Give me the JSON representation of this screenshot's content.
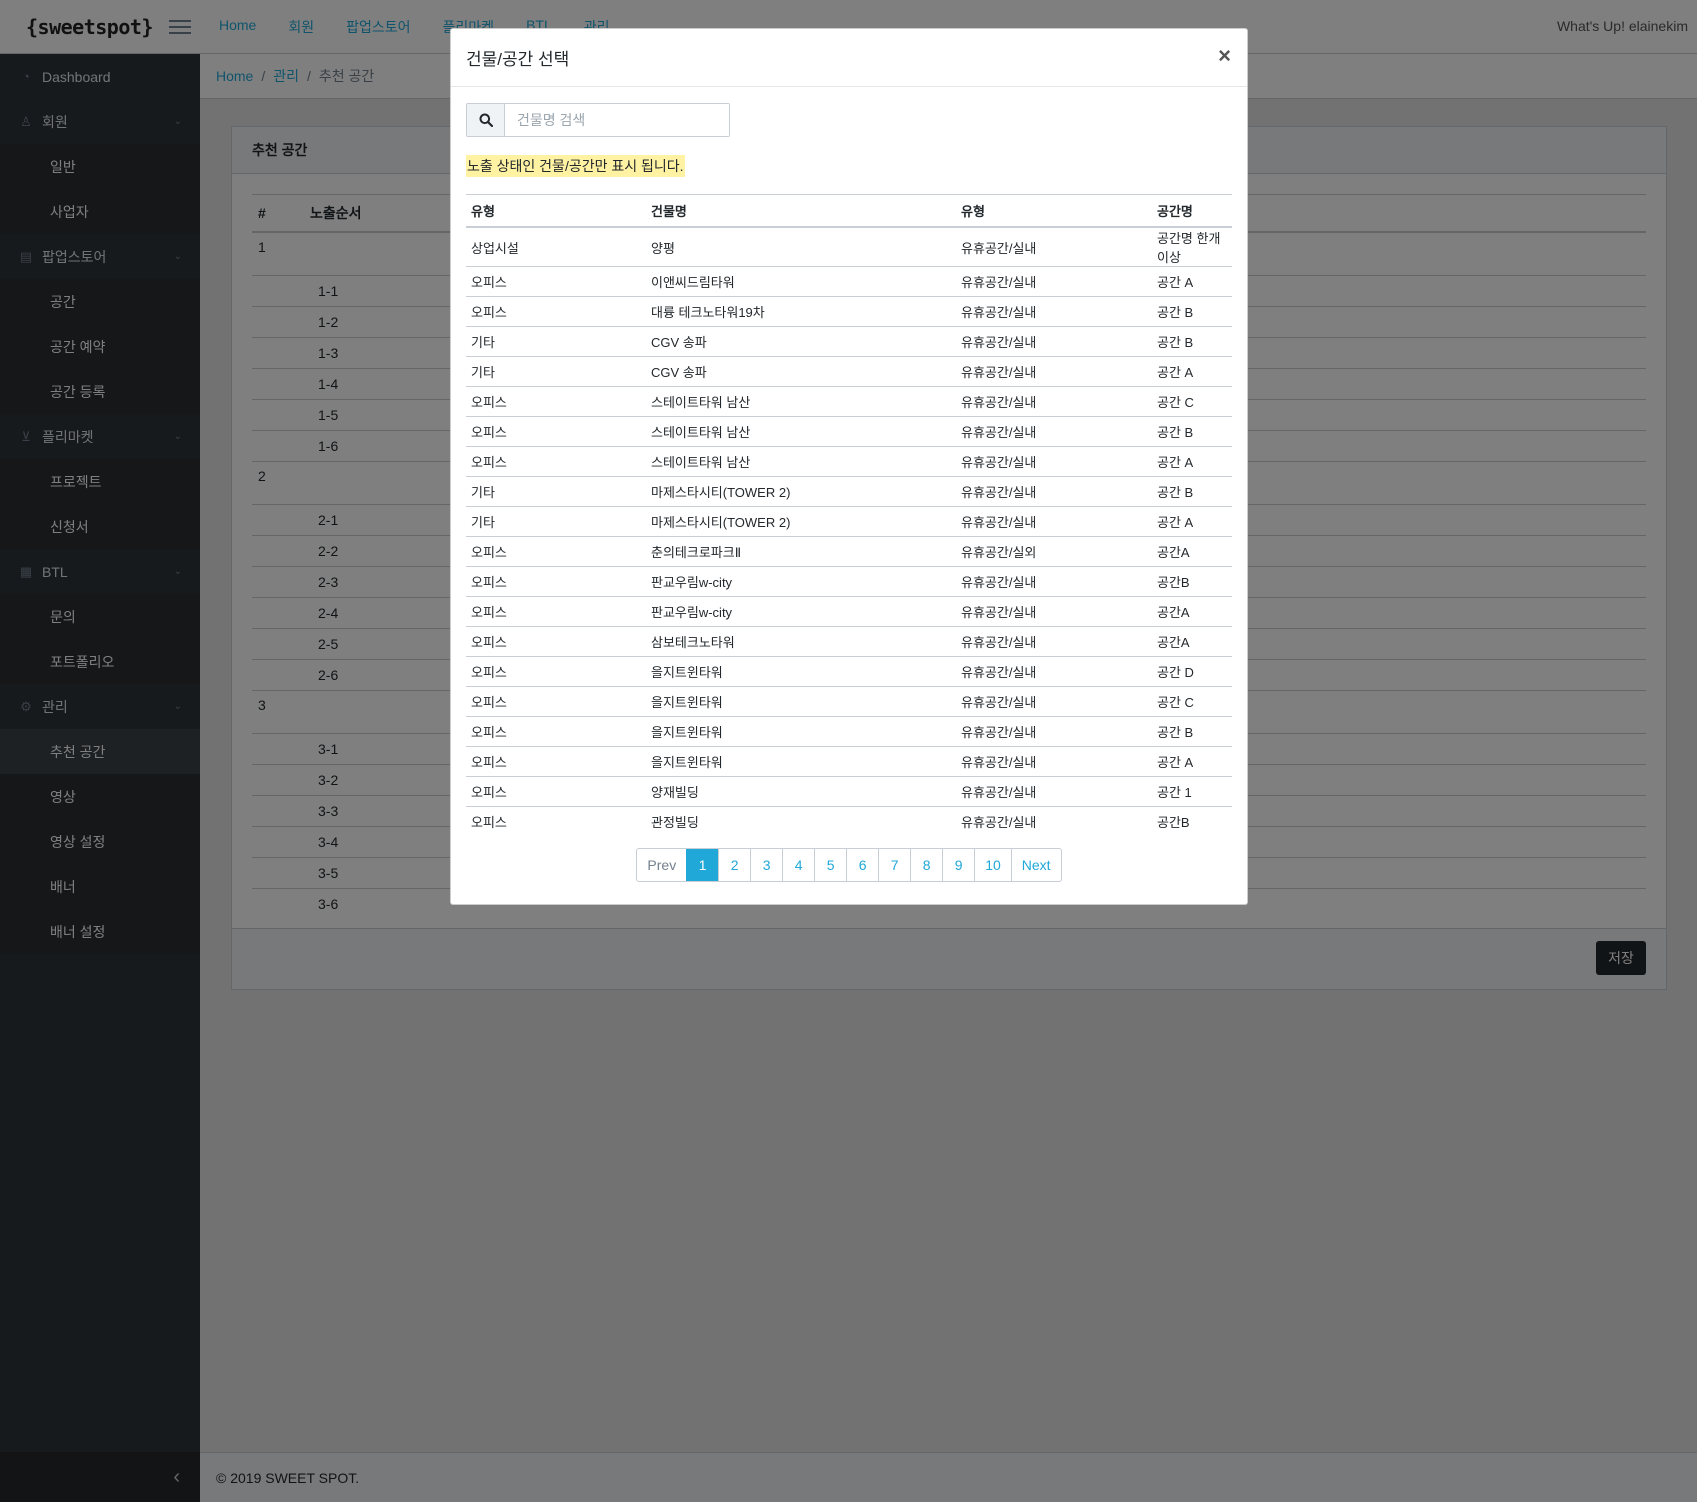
{
  "header": {
    "logo": "{sweetspot}",
    "nav": [
      "Home",
      "회원",
      "팝업스토어",
      "플리마켓",
      "BTL",
      "관리"
    ],
    "user_greeting": "What's Up! elainekim"
  },
  "sidebar": {
    "items": [
      {
        "label": "Dashboard",
        "kind": "title",
        "icon": "dashboard-icon"
      },
      {
        "label": "회원",
        "kind": "title",
        "icon": "user-icon",
        "expandable": true
      },
      {
        "label": "일반",
        "kind": "sub"
      },
      {
        "label": "사업자",
        "kind": "sub"
      },
      {
        "label": "팝업스토어",
        "kind": "title",
        "icon": "store-icon",
        "expandable": true
      },
      {
        "label": "공간",
        "kind": "sub"
      },
      {
        "label": "공간 예약",
        "kind": "sub"
      },
      {
        "label": "공간 등록",
        "kind": "sub"
      },
      {
        "label": "플리마켓",
        "kind": "title",
        "icon": "cart-icon",
        "expandable": true
      },
      {
        "label": "프로젝트",
        "kind": "sub"
      },
      {
        "label": "신청서",
        "kind": "sub"
      },
      {
        "label": "BTL",
        "kind": "title",
        "icon": "grid-icon",
        "expandable": true
      },
      {
        "label": "문의",
        "kind": "sub"
      },
      {
        "label": "포트폴리오",
        "kind": "sub"
      },
      {
        "label": "관리",
        "kind": "title",
        "icon": "gear-icon",
        "expandable": true
      },
      {
        "label": "추천 공간",
        "kind": "sub",
        "active": true
      },
      {
        "label": "영상",
        "kind": "sub"
      },
      {
        "label": "영상 설정",
        "kind": "sub"
      },
      {
        "label": "배너",
        "kind": "sub"
      },
      {
        "label": "배너 설정",
        "kind": "sub"
      }
    ]
  },
  "breadcrumb": {
    "home": "Home",
    "section": "관리",
    "current": "추천 공간"
  },
  "card": {
    "title": "추천 공간",
    "columns": [
      "#",
      "노출순서"
    ],
    "rows": [
      {
        "num": "1",
        "order": ""
      },
      {
        "num": "",
        "order": "1-1"
      },
      {
        "num": "",
        "order": "1-2"
      },
      {
        "num": "",
        "order": "1-3"
      },
      {
        "num": "",
        "order": "1-4"
      },
      {
        "num": "",
        "order": "1-5"
      },
      {
        "num": "",
        "order": "1-6"
      },
      {
        "num": "2",
        "order": ""
      },
      {
        "num": "",
        "order": "2-1"
      },
      {
        "num": "",
        "order": "2-2"
      },
      {
        "num": "",
        "order": "2-3"
      },
      {
        "num": "",
        "order": "2-4"
      },
      {
        "num": "",
        "order": "2-5"
      },
      {
        "num": "",
        "order": "2-6"
      },
      {
        "num": "3",
        "order": ""
      },
      {
        "num": "",
        "order": "3-1"
      },
      {
        "num": "",
        "order": "3-2"
      },
      {
        "num": "",
        "order": "3-3"
      },
      {
        "num": "",
        "order": "3-4"
      },
      {
        "num": "",
        "order": "3-5"
      },
      {
        "num": "",
        "order": "3-6"
      }
    ],
    "save_label": "저장"
  },
  "footer": {
    "copyright": "© 2019 SWEET SPOT."
  },
  "modal": {
    "title": "건물/공간 선택",
    "close": "×",
    "search_placeholder": "건물명 검색",
    "search_value": "",
    "notice": "노출 상태인 건물/공간만 표시 됩니다.",
    "columns": [
      "유형",
      "건물명",
      "유형",
      "공간명"
    ],
    "rows": [
      [
        "상업시설",
        "양평",
        "유휴공간/실내",
        "공간명 한개이상"
      ],
      [
        "오피스",
        "이앤씨드림타워",
        "유휴공간/실내",
        "공간 A"
      ],
      [
        "오피스",
        "대륭 테크노타워19차",
        "유휴공간/실내",
        "공간 B"
      ],
      [
        "기타",
        "CGV 송파",
        "유휴공간/실내",
        "공간 B"
      ],
      [
        "기타",
        "CGV 송파",
        "유휴공간/실내",
        "공간 A"
      ],
      [
        "오피스",
        "스테이트타워 남산",
        "유휴공간/실내",
        "공간 C"
      ],
      [
        "오피스",
        "스테이트타워 남산",
        "유휴공간/실내",
        "공간 B"
      ],
      [
        "오피스",
        "스테이트타워 남산",
        "유휴공간/실내",
        "공간 A"
      ],
      [
        "기타",
        "마제스타시티(TOWER 2)",
        "유휴공간/실내",
        "공간 B"
      ],
      [
        "기타",
        "마제스타시티(TOWER 2)",
        "유휴공간/실내",
        "공간 A"
      ],
      [
        "오피스",
        "춘의테크로파크Ⅱ",
        "유휴공간/실외",
        "공간A"
      ],
      [
        "오피스",
        "판교우림w-city",
        "유휴공간/실내",
        "공간B"
      ],
      [
        "오피스",
        "판교우림w-city",
        "유휴공간/실내",
        "공간A"
      ],
      [
        "오피스",
        "삼보테크노타워",
        "유휴공간/실내",
        "공간A"
      ],
      [
        "오피스",
        "을지트윈타워",
        "유휴공간/실내",
        "공간 D"
      ],
      [
        "오피스",
        "을지트윈타워",
        "유휴공간/실내",
        "공간 C"
      ],
      [
        "오피스",
        "을지트윈타워",
        "유휴공간/실내",
        "공간 B"
      ],
      [
        "오피스",
        "을지트윈타워",
        "유휴공간/실내",
        "공간 A"
      ],
      [
        "오피스",
        "양재빌딩",
        "유휴공간/실내",
        "공간 1"
      ],
      [
        "오피스",
        "관정빌딩",
        "유휴공간/실내",
        "공간B"
      ]
    ],
    "pagination": {
      "prev": "Prev",
      "pages": [
        "1",
        "2",
        "3",
        "4",
        "5",
        "6",
        "7",
        "8",
        "9",
        "10"
      ],
      "next": "Next",
      "current": "1"
    }
  },
  "colors": {
    "accent": "#20a8d8",
    "sidebar_bg": "#2f353a",
    "notice_bg": "#fff3a3",
    "save_bg": "#23282c"
  }
}
